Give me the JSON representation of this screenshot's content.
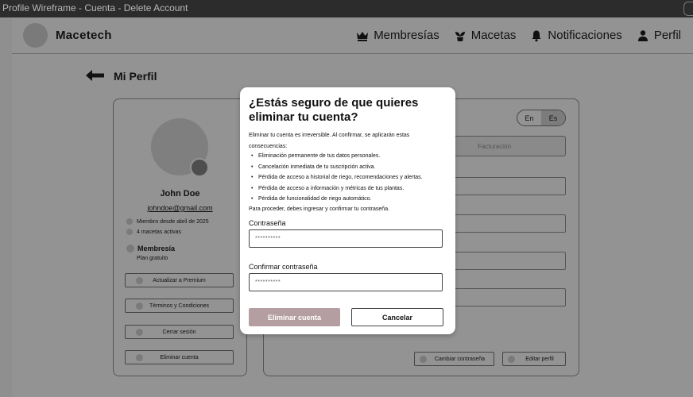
{
  "window": {
    "title": "Profile Wireframe - Cuenta - Delete Account"
  },
  "header": {
    "brand": "Macetech",
    "nav": [
      {
        "label": "Membresías",
        "icon": "crown-icon"
      },
      {
        "label": "Macetas",
        "icon": "plant-icon"
      },
      {
        "label": "Notificaciones",
        "icon": "bell-icon"
      },
      {
        "label": "Perfil",
        "icon": "user-icon"
      }
    ]
  },
  "page": {
    "title": "Mi Perfil"
  },
  "profile": {
    "name": "John Doe",
    "email": "johndoe@gmail.com",
    "member_since": "Miembro desde abril de 2025",
    "pots": "4 macetas activas",
    "membership_label": "Membresía",
    "membership_plan": "Plan gratuito",
    "buttons": {
      "upgrade": "Actualizar a Premium",
      "terms": "Términos y Condiciones",
      "logout": "Cerrar sesión",
      "delete": "Eliminar cuenta"
    }
  },
  "settings": {
    "lang_en": "En",
    "lang_es": "Es",
    "tab_billing": "Facturación",
    "change_password": "Cambiar contraseña",
    "edit_profile": "Editar perfil"
  },
  "modal": {
    "title": "¿Estás seguro de que quieres eliminar tu cuenta?",
    "intro": "Eliminar tu cuenta es irreversible. Al confirmar, se aplicarán estas consecuencias:",
    "consequences": [
      "Eliminación permanente de tus datos personales.",
      "Cancelación inmediata de tu suscripción activa.",
      "Pérdida de acceso a historial de riego, recomendaciones y alertas.",
      "Pérdida de acceso a información y métricas de tus plantas.",
      "Pérdida de funcionalidad de riego automático."
    ],
    "note": "Para proceder, debes ingresar y confirmar tu contraseña.",
    "password_label": "Contraseña",
    "password_value": "**********",
    "confirm_label": "Confirmar contraseña",
    "confirm_value": "**********",
    "delete_button": "Eliminar cuenta",
    "cancel_button": "Cancelar"
  },
  "colors": {
    "overlay": "#939393",
    "modal_bg": "#ffffff",
    "delete_button": "#b59ea1"
  }
}
